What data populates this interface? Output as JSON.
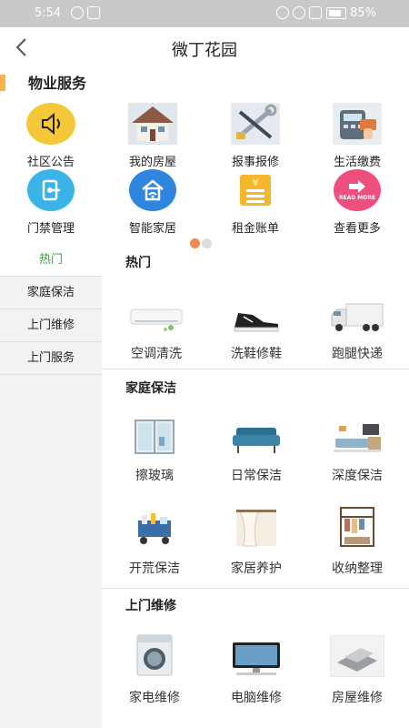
{
  "status_bar": {
    "time": "5:54",
    "battery": "85%"
  },
  "header": {
    "title": "微丁花园"
  },
  "property": {
    "section_title": "物业服务",
    "items": [
      {
        "label": "社区公告",
        "icon": "speaker-icon",
        "color": "#f5c83a"
      },
      {
        "label": "我的房屋",
        "icon": "house-icon",
        "color": "#b8c4cf"
      },
      {
        "label": "报事报修",
        "icon": "tools-icon",
        "color": "#c9d2da"
      },
      {
        "label": "生活缴费",
        "icon": "payment-terminal-icon",
        "color": "#d5dbe2"
      },
      {
        "label": "门禁管理",
        "icon": "door-access-icon",
        "color": "#3ab4e8"
      },
      {
        "label": "智能家居",
        "icon": "smart-home-icon",
        "color": "#2f86df"
      },
      {
        "label": "租金账单",
        "icon": "bill-icon",
        "color": "#f6b72d"
      },
      {
        "label": "查看更多",
        "icon": "read-more-icon",
        "color": "#ef4f7d",
        "badge_text": "READ MORE"
      }
    ],
    "page_dots": {
      "active_color": "#f08a52",
      "inactive_color": "#dddddd"
    }
  },
  "sidebar": {
    "items": [
      {
        "label": "热门",
        "active": true
      },
      {
        "label": "家庭保洁",
        "active": false
      },
      {
        "label": "上门维修",
        "active": false
      },
      {
        "label": "上门服务",
        "active": false
      }
    ],
    "active_color": "#3aa03a"
  },
  "categories": [
    {
      "title": "热门",
      "items": [
        {
          "label": "空调清洗",
          "icon": "air-conditioner-icon"
        },
        {
          "label": "洗鞋修鞋",
          "icon": "sneaker-icon"
        },
        {
          "label": "跑腿快递",
          "icon": "delivery-truck-icon"
        }
      ]
    },
    {
      "title": "家庭保洁",
      "items": [
        {
          "label": "擦玻璃",
          "icon": "window-icon"
        },
        {
          "label": "日常保洁",
          "icon": "sofa-icon"
        },
        {
          "label": "深度保洁",
          "icon": "living-room-icon"
        },
        {
          "label": "开荒保洁",
          "icon": "cleaning-cart-icon"
        },
        {
          "label": "家居养护",
          "icon": "curtain-icon"
        },
        {
          "label": "收纳整理",
          "icon": "wardrobe-icon"
        }
      ]
    },
    {
      "title": "上门维修",
      "items": [
        {
          "label": "家电维修",
          "icon": "washing-machine-icon"
        },
        {
          "label": "电脑维修",
          "icon": "computer-icon"
        },
        {
          "label": "房屋维修",
          "icon": "tiles-icon"
        }
      ]
    }
  ]
}
